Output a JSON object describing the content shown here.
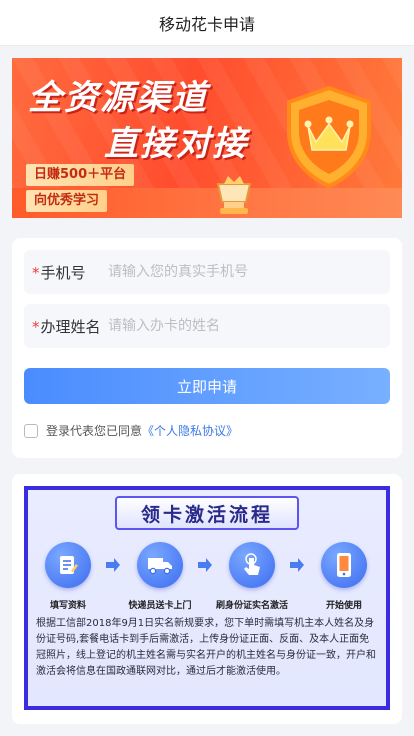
{
  "nav": {
    "title": "移动花卡申请"
  },
  "banner": {
    "headline_1": "全资源渠道",
    "headline_2": "直接对接",
    "tag_1": "日赚500＋平台",
    "tag_2": "向优秀学习"
  },
  "form": {
    "phone_label": "手机号",
    "phone_placeholder": "请输入您的真实手机号",
    "phone_value": "",
    "name_label": "办理姓名",
    "name_placeholder": "请输入办卡的姓名",
    "name_value": "",
    "required_mark": "*",
    "submit_label": "立即申请",
    "agree_text": "登录代表您已同意",
    "agree_link": "《个人隐私协议》",
    "agreed": false
  },
  "flow": {
    "title": "领卡激活流程",
    "steps": [
      {
        "label": "填写资料",
        "icon": "form-icon"
      },
      {
        "label": "快递员送卡上门",
        "icon": "truck-icon"
      },
      {
        "label": "刷身份证实名激活",
        "icon": "tap-icon"
      },
      {
        "label": "开始使用",
        "icon": "phone-icon"
      }
    ],
    "description": "根据工信部2018年9月1日实名新规要求，您下单时需填写机主本人姓名及身份证号码,套餐电话卡到手后需激活，上传身份证正面、反面、及本人正面免冠照片，线上登记的机主姓名需与实名开户的机主姓名与身份证一致，开户和激活会将信息在国政通联网对比，通过后才能激活使用。"
  },
  "colors": {
    "accent": "#4a8cff",
    "required": "#ef3b3b",
    "link": "#3a78e8",
    "banner": "#ff4d2e",
    "flow_border": "#3c2ce0"
  }
}
